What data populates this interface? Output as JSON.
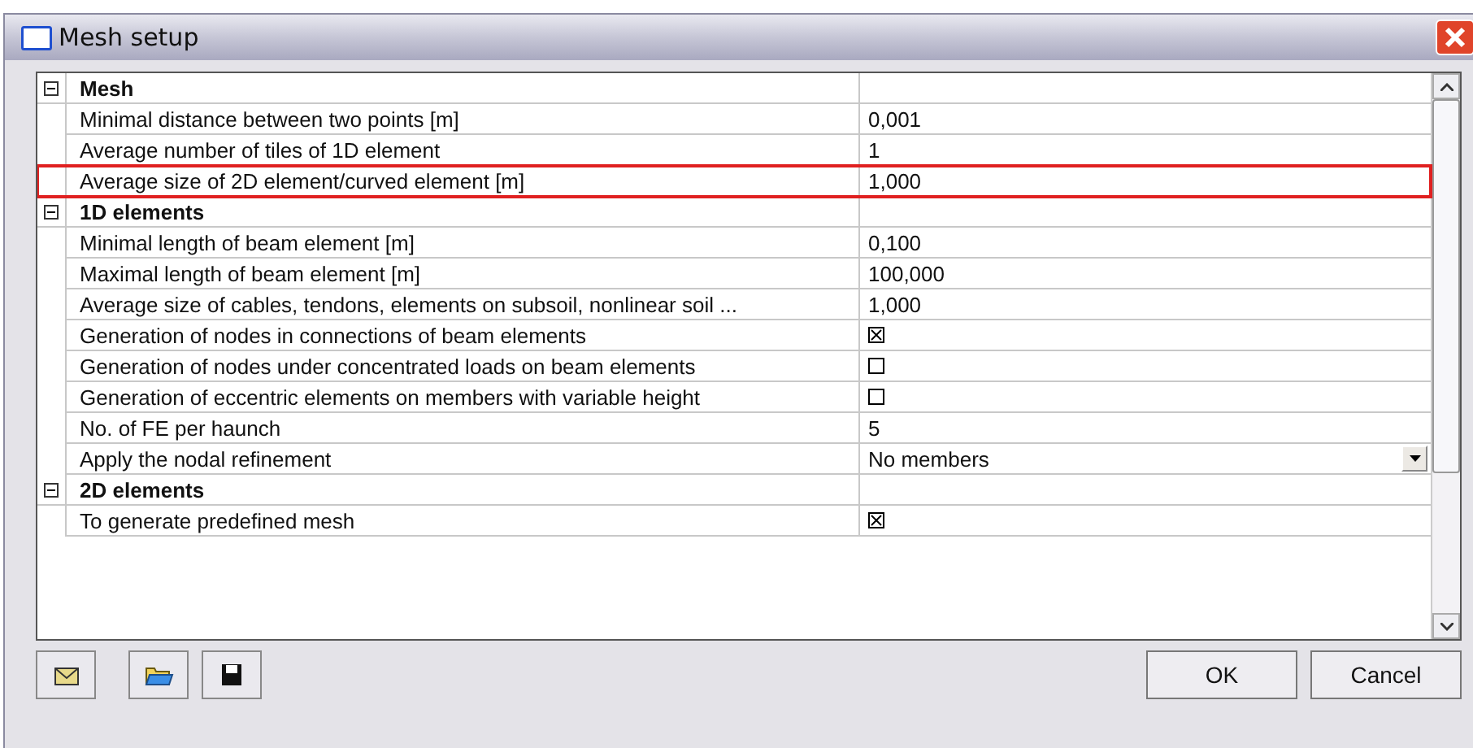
{
  "window": {
    "title": "Mesh setup"
  },
  "groups": [
    {
      "title": "Mesh",
      "expanded": true,
      "rows": [
        {
          "kind": "text",
          "label": "Minimal distance between two points [m]",
          "value": "0,001",
          "highlighted": false
        },
        {
          "kind": "text",
          "label": "Average number of tiles of 1D element",
          "value": "1",
          "highlighted": false
        },
        {
          "kind": "text",
          "label": "Average size of 2D element/curved element [m]",
          "value": "1,000",
          "highlighted": true
        }
      ]
    },
    {
      "title": "1D elements",
      "expanded": true,
      "rows": [
        {
          "kind": "text",
          "label": "Minimal length of beam element [m]",
          "value": "0,100",
          "highlighted": false
        },
        {
          "kind": "text",
          "label": "Maximal length of beam element [m]",
          "value": "100,000",
          "highlighted": false
        },
        {
          "kind": "text",
          "label": "Average size of cables, tendons, elements on subsoil, nonlinear soil ...",
          "value": "1,000",
          "highlighted": false
        },
        {
          "kind": "checkbox",
          "label": "Generation of nodes in connections of beam elements",
          "checked": true,
          "highlighted": false
        },
        {
          "kind": "checkbox",
          "label": "Generation of nodes under concentrated loads on beam elements",
          "checked": false,
          "highlighted": false
        },
        {
          "kind": "checkbox",
          "label": "Generation of eccentric elements on members with variable height",
          "checked": false,
          "highlighted": false
        },
        {
          "kind": "text",
          "label": "No. of FE per haunch",
          "value": "5",
          "highlighted": false
        },
        {
          "kind": "dropdown",
          "label": "Apply the nodal refinement",
          "value": "No members",
          "highlighted": false
        }
      ]
    },
    {
      "title": "2D elements",
      "expanded": true,
      "rows": [
        {
          "kind": "checkbox",
          "label": "To generate predefined mesh",
          "checked": true,
          "highlighted": false
        }
      ]
    }
  ],
  "buttons": [
    "OK",
    "Cancel"
  ]
}
